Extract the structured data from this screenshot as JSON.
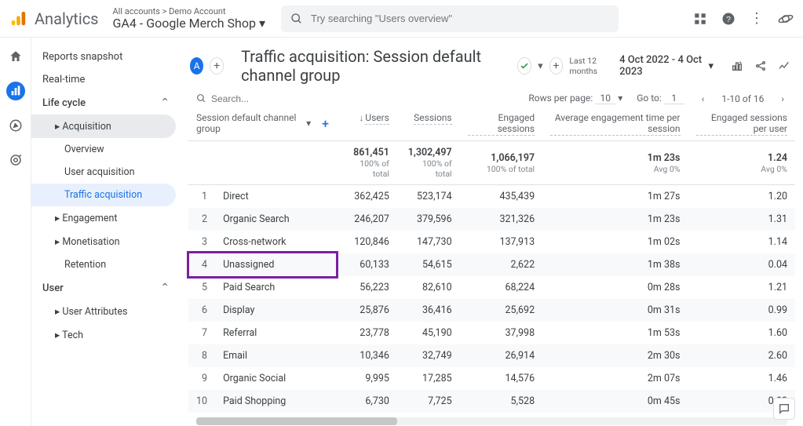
{
  "brand": "Analytics",
  "account_path": "All accounts > Demo Account",
  "property": "GA4 - Google Merch Shop",
  "search_placeholder": "Try searching \"Users overview\"",
  "sidebar": {
    "snapshot": "Reports snapshot",
    "realtime": "Real-time",
    "lifecycle": "Life cycle",
    "acquisition": "Acquisition",
    "overview": "Overview",
    "user_acq": "User acquisition",
    "traffic_acq": "Traffic acquisition",
    "engagement": "Engagement",
    "monetisation": "Monetisation",
    "retention": "Retention",
    "user": "User",
    "user_attr": "User Attributes",
    "tech": "Tech"
  },
  "report_title": "Traffic acquisition: Session default channel group",
  "avatar_letter": "A",
  "date_label": "Last 12 months",
  "date_range": "4 Oct 2022 - 4 Oct 2023",
  "table_controls": {
    "search_placeholder": "Search...",
    "rows_per_page_label": "Rows per page:",
    "rows_per_page_value": "10",
    "goto_label": "Go to:",
    "goto_value": "1",
    "range": "1-10 of 16"
  },
  "dimension_label": "Session default channel group",
  "columns": {
    "users": "Users",
    "sessions": "Sessions",
    "engaged": "Engaged sessions",
    "avg_engagement": "Average engagement time per session",
    "engaged_per_user": "Engaged sessions per user"
  },
  "totals": {
    "users": "861,451",
    "users_sub": "100% of total",
    "sessions": "1,302,497",
    "sessions_sub": "100% of total",
    "engaged": "1,066,197",
    "engaged_sub": "100% of total",
    "avg": "1m 23s",
    "avg_sub": "Avg 0%",
    "epu": "1.24",
    "epu_sub": "Avg 0%"
  },
  "rows": [
    {
      "idx": "1",
      "dim": "Direct",
      "users": "362,425",
      "sessions": "523,174",
      "engaged": "435,439",
      "avg": "1m 27s",
      "epu": "1.20"
    },
    {
      "idx": "2",
      "dim": "Organic Search",
      "users": "246,207",
      "sessions": "379,596",
      "engaged": "321,326",
      "avg": "1m 23s",
      "epu": "1.31"
    },
    {
      "idx": "3",
      "dim": "Cross-network",
      "users": "120,846",
      "sessions": "147,730",
      "engaged": "137,913",
      "avg": "1m 02s",
      "epu": "1.14"
    },
    {
      "idx": "4",
      "dim": "Unassigned",
      "users": "60,133",
      "sessions": "54,615",
      "engaged": "2,622",
      "avg": "1m 38s",
      "epu": "0.04"
    },
    {
      "idx": "5",
      "dim": "Paid Search",
      "users": "56,223",
      "sessions": "82,610",
      "engaged": "68,224",
      "avg": "0m 28s",
      "epu": "1.21"
    },
    {
      "idx": "6",
      "dim": "Display",
      "users": "25,876",
      "sessions": "36,416",
      "engaged": "25,692",
      "avg": "0m 31s",
      "epu": "0.99"
    },
    {
      "idx": "7",
      "dim": "Referral",
      "users": "23,778",
      "sessions": "45,190",
      "engaged": "37,998",
      "avg": "1m 53s",
      "epu": "1.60"
    },
    {
      "idx": "8",
      "dim": "Email",
      "users": "10,346",
      "sessions": "32,749",
      "engaged": "26,914",
      "avg": "2m 30s",
      "epu": "2.60"
    },
    {
      "idx": "9",
      "dim": "Organic Social",
      "users": "9,995",
      "sessions": "17,285",
      "engaged": "14,576",
      "avg": "2m 07s",
      "epu": "1.46"
    },
    {
      "idx": "10",
      "dim": "Paid Shopping",
      "users": "6,730",
      "sessions": "7,725",
      "engaged": "5,528",
      "avg": "0m 45s",
      "epu": "0.82"
    }
  ],
  "highlight_row": 3
}
